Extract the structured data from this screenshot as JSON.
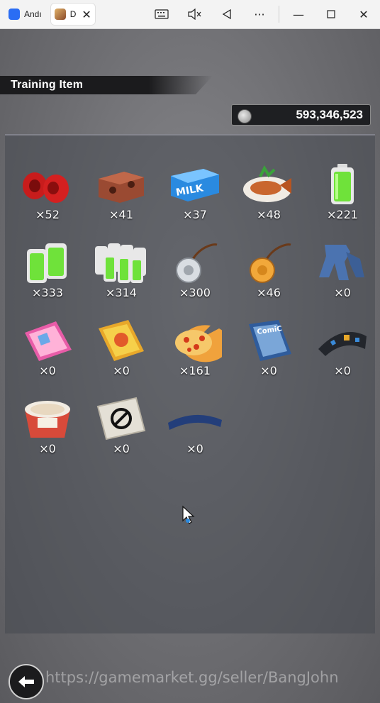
{
  "window": {
    "tabs": [
      {
        "label": "Andı",
        "icon": "app-icon"
      },
      {
        "label": "D",
        "icon": "game-icon",
        "active": true
      }
    ],
    "controls": [
      "keyboard-icon",
      "mute-icon",
      "back-triangle-icon",
      "more-icon",
      "minimize-icon",
      "maximize-icon",
      "close-icon"
    ]
  },
  "header": {
    "title": "Training Item"
  },
  "currency": {
    "icon": "coin-icon",
    "value": "593,346,523"
  },
  "items": [
    {
      "icon": "red-weights-icon",
      "count": "×52"
    },
    {
      "icon": "brick-block-icon",
      "count": "×41"
    },
    {
      "icon": "milk-carton-icon",
      "count": "×37"
    },
    {
      "icon": "fish-dish-icon",
      "count": "×48"
    },
    {
      "icon": "green-battery-icon",
      "count": "×221"
    },
    {
      "icon": "double-battery-icon",
      "count": "×333"
    },
    {
      "icon": "battery-pack-icon",
      "count": "×314"
    },
    {
      "icon": "silver-pendant-icon",
      "count": "×300"
    },
    {
      "icon": "gold-pendant-icon",
      "count": "×46"
    },
    {
      "icon": "jeans-icon",
      "count": "×0"
    },
    {
      "icon": "pink-magazine-icon",
      "count": "×0"
    },
    {
      "icon": "yellow-magazine-icon",
      "count": "×0"
    },
    {
      "icon": "pizza-icon",
      "count": "×161"
    },
    {
      "icon": "comic-book-icon",
      "count": "×0"
    },
    {
      "icon": "headband-icon",
      "count": "×0"
    },
    {
      "icon": "cup-noodle-icon",
      "count": "×0"
    },
    {
      "icon": "emblem-card-icon",
      "count": "×0"
    },
    {
      "icon": "blue-band-icon",
      "count": "×0"
    }
  ],
  "watermark": "https://gamemarket.gg/seller/BangJohn",
  "footer": {
    "back_icon": "back-arrow-icon"
  }
}
